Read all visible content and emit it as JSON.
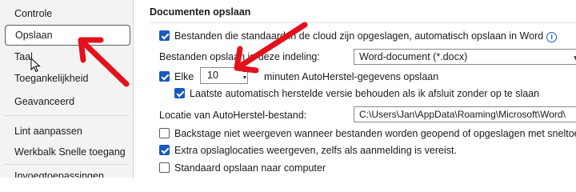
{
  "sidebar": {
    "items": [
      {
        "label": "Controle",
        "selected": false
      },
      {
        "label": "Opslaan",
        "selected": true
      },
      {
        "label": "Taal",
        "selected": false
      },
      {
        "label": "Toegankelijkheid",
        "selected": false
      },
      {
        "label": "Geavanceerd",
        "selected": false
      },
      {
        "label": "Lint aanpassen",
        "selected": false
      },
      {
        "label": "Werkbalk Snelle toegang",
        "selected": false
      },
      {
        "label": "Invoegtoepassingen",
        "selected": false
      }
    ]
  },
  "main": {
    "section_title": "Documenten opslaan",
    "autosave_cloud": {
      "checked": true,
      "label": "Bestanden die standaard in de cloud zijn opgeslagen, automatisch opslaan in Word"
    },
    "save_format": {
      "label": "Bestanden opslaan in deze indeling:",
      "value": "Word-document (*.docx)"
    },
    "autorecover": {
      "checked": true,
      "label_before": "Elke",
      "minutes_value": "10",
      "label_after": "minuten AutoHerstel-gegevens opslaan"
    },
    "keep_last_version": {
      "checked": true,
      "label": "Laatste automatisch herstelde versie behouden als ik afsluit zonder op te slaan"
    },
    "autorecover_location": {
      "label": "Locatie van AutoHerstel-bestand:",
      "value": "C:\\Users\\Jan\\AppData\\Roaming\\Microsoft\\Word\\"
    },
    "backstage": {
      "checked": false,
      "label": "Backstage niet weergeven wanneer bestanden worden geopend of opgeslagen met sneltoetsen"
    },
    "extra_locations": {
      "checked": true,
      "label": "Extra opslaglocaties weergeven, zelfs als aanmelding is vereist."
    },
    "save_to_computer": {
      "checked": false,
      "label": "Standaard opslaan naar computer"
    }
  },
  "colors": {
    "accent": "#185abd",
    "annotation_arrow": "#e3111b"
  },
  "icons": {
    "info": "info-icon",
    "dropdown": "chevron-down-icon",
    "cursor": "mouse-pointer-icon"
  }
}
